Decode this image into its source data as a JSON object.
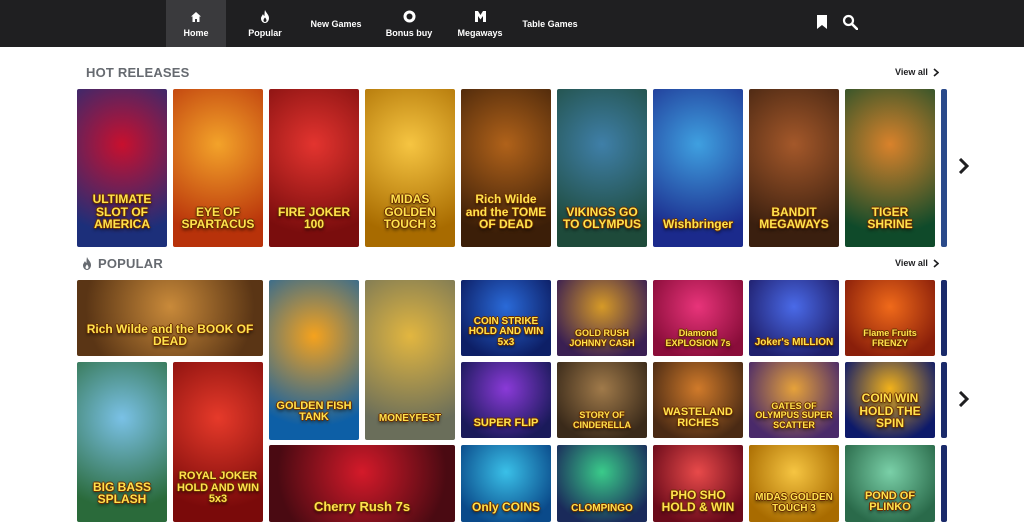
{
  "nav": [
    {
      "label": "Home",
      "icon": "home-icon",
      "active": true
    },
    {
      "label": "Popular",
      "icon": "flame-icon"
    },
    {
      "label": "New Games",
      "icon": ""
    },
    {
      "label": "Bonus buy",
      "icon": "bonus-coin-icon"
    },
    {
      "label": "Megaways",
      "icon": "megaways-m-icon"
    },
    {
      "label": "Table Games",
      "icon": ""
    }
  ],
  "header_icons": [
    "bookmark-icon",
    "search-icon"
  ],
  "hot_releases": {
    "title": "HOT RELEASES",
    "view_all": "View all",
    "games": [
      {
        "title": "ULTIMATE SLOT OF AMERICA",
        "colors": [
          "#1c2f7a",
          "#c8102e"
        ]
      },
      {
        "title": "EYE OF SPARTACUS",
        "colors": [
          "#b8320a",
          "#f3a32a"
        ]
      },
      {
        "title": "FIRE JOKER 100",
        "colors": [
          "#7a0d0d",
          "#e3342f"
        ]
      },
      {
        "title": "MIDAS GOLDEN TOUCH 3",
        "colors": [
          "#a86b00",
          "#f6c542"
        ]
      },
      {
        "title": "Rich Wilde and the TOME OF DEAD",
        "colors": [
          "#3b1e08",
          "#b0621a"
        ]
      },
      {
        "title": "VIKINGS GO TO OLYMPUS",
        "colors": [
          "#1e4a3a",
          "#3f7fa8"
        ]
      },
      {
        "title": "Wishbringer",
        "colors": [
          "#1b2a8c",
          "#3fa0e0"
        ]
      },
      {
        "title": "BANDIT MEGAWAYS",
        "colors": [
          "#3a1f0f",
          "#a4582a"
        ]
      },
      {
        "title": "TIGER SHRINE",
        "colors": [
          "#0f4a2a",
          "#d9822b"
        ]
      }
    ]
  },
  "popular": {
    "title": "POPULAR",
    "view_all": "View all",
    "games": [
      {
        "title": "Rich Wilde and the BOOK OF DEAD",
        "colors": [
          "#5a3515",
          "#c98a3a"
        ]
      },
      {
        "title": "GOLDEN FISH TANK",
        "colors": [
          "#0d5fa6",
          "#f5a21d"
        ]
      },
      {
        "title": "MONEYFEST",
        "colors": [
          "#6a6e5a",
          "#e2b640"
        ]
      },
      {
        "title": "COIN STRIKE HOLD AND WIN 5x3",
        "colors": [
          "#0d1f66",
          "#2a6ad8"
        ]
      },
      {
        "title": "GOLD RUSH JOHNNY CASH",
        "colors": [
          "#3a1f52",
          "#d69a27"
        ]
      },
      {
        "title": "Diamond EXPLOSION 7s",
        "colors": [
          "#8a0d3a",
          "#e8347a"
        ]
      },
      {
        "title": "Joker's MILLION",
        "colors": [
          "#20206e",
          "#4a6ae8"
        ]
      },
      {
        "title": "Flame Fruits FRENZY",
        "colors": [
          "#8a1f0a",
          "#f06a1a"
        ]
      },
      {
        "title": "BIG BASS SPLASH",
        "colors": [
          "#2a6a3a",
          "#7ac1e6"
        ]
      },
      {
        "title": "ROYAL JOKER HOLD AND WIN 5x3",
        "colors": [
          "#7a0a0a",
          "#e63a2a"
        ]
      },
      {
        "title": "SUPER FLIP",
        "colors": [
          "#1a1a5a",
          "#8a3ad8"
        ]
      },
      {
        "title": "STORY OF CINDERELLA",
        "colors": [
          "#3a2a1a",
          "#a07a4a"
        ]
      },
      {
        "title": "WASTELAND RICHES",
        "colors": [
          "#4a2a14",
          "#d07a2a"
        ]
      },
      {
        "title": "GATES OF OLYMPUS SUPER SCATTER",
        "colors": [
          "#4a2a6a",
          "#e6a23a"
        ]
      },
      {
        "title": "COIN WIN HOLD THE SPIN",
        "colors": [
          "#0d1a6a",
          "#f2b21a"
        ]
      },
      {
        "title": "Cherry Rush 7s",
        "colors": [
          "#4a0a12",
          "#d41a2a"
        ]
      },
      {
        "title": "Only COINS",
        "colors": [
          "#0a4a8a",
          "#3ac0e8"
        ]
      },
      {
        "title": "CLOMPINGO",
        "colors": [
          "#1a2a5a",
          "#3acb8a"
        ]
      },
      {
        "title": "PHO SHO HOLD & WIN",
        "colors": [
          "#6a0a1a",
          "#e84a4a"
        ]
      },
      {
        "title": "MIDAS GOLDEN TOUCH 3",
        "colors": [
          "#a86b00",
          "#f6c542"
        ]
      },
      {
        "title": "POND OF PLINKO",
        "colors": [
          "#2a6a4a",
          "#7ad0a8"
        ]
      }
    ]
  }
}
